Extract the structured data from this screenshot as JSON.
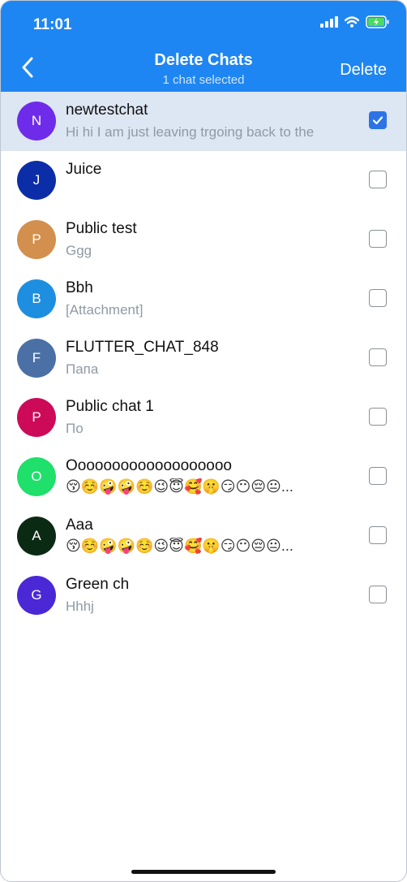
{
  "status_bar": {
    "time": "11:01"
  },
  "header": {
    "title": "Delete Chats",
    "subtitle": "1 chat selected",
    "delete_label": "Delete"
  },
  "colors": {
    "header": "#1e86f2",
    "selected_row": "#dde6f3",
    "checkbox_checked": "#2c74e6"
  },
  "chats": [
    {
      "initial": "N",
      "title": "newtestchat",
      "subtitle": "Hi hi I am just leaving trgoing back to the",
      "color": "#6e2cea",
      "selected": true
    },
    {
      "initial": "J",
      "title": "Juice",
      "subtitle": "",
      "color": "#0b2ea8",
      "selected": false
    },
    {
      "initial": "P",
      "title": "Public test",
      "subtitle": "Ggg",
      "color": "#d38f4d",
      "selected": false
    },
    {
      "initial": "B",
      "title": "Bbh",
      "subtitle": "[Attachment]",
      "color": "#1e8fe0",
      "selected": false
    },
    {
      "initial": "F",
      "title": "FLUTTER_CHAT_848",
      "subtitle": "Папа",
      "color": "#4a70a5",
      "selected": false
    },
    {
      "initial": "P",
      "title": "Public chat 1",
      "subtitle": "По",
      "color": "#cc0a58",
      "selected": false
    },
    {
      "initial": "O",
      "title": "Ooooooooooooooooooo",
      "subtitle": "😚☺️🤪🤪☺️😉😇🥰🤫😏😶😔😐...",
      "color": "#1ee06a",
      "selected": false,
      "emoji": true
    },
    {
      "initial": "A",
      "title": "Aaa",
      "subtitle": "😚☺️🤪🤪☺️😉😇🥰🤫😏😶😔😐...",
      "color": "#0b2a14",
      "selected": false,
      "emoji": true
    },
    {
      "initial": "G",
      "title": "Green  ch",
      "subtitle": "Hhhj",
      "color": "#4a28d6",
      "selected": false
    }
  ]
}
